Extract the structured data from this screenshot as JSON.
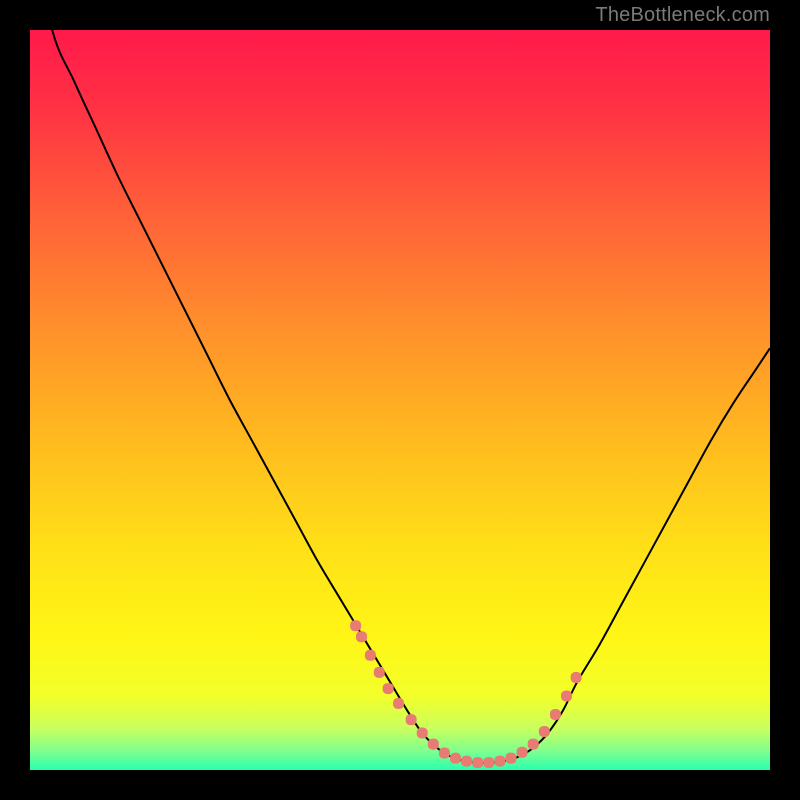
{
  "watermark": "TheBottleneck.com",
  "colors": {
    "background": "#000000",
    "curve": "#000000",
    "markers": "#e87c72",
    "gradient_stops": [
      {
        "offset": 0.0,
        "color": "#ff1a4b"
      },
      {
        "offset": 0.1,
        "color": "#ff3044"
      },
      {
        "offset": 0.25,
        "color": "#ff6138"
      },
      {
        "offset": 0.4,
        "color": "#ff8f2c"
      },
      {
        "offset": 0.55,
        "color": "#ffb91f"
      },
      {
        "offset": 0.7,
        "color": "#ffe018"
      },
      {
        "offset": 0.82,
        "color": "#fff615"
      },
      {
        "offset": 0.9,
        "color": "#f3ff2a"
      },
      {
        "offset": 0.945,
        "color": "#c8ff60"
      },
      {
        "offset": 0.975,
        "color": "#7dff8f"
      },
      {
        "offset": 1.0,
        "color": "#2bffb0"
      }
    ]
  },
  "chart_data": {
    "type": "line",
    "title": "",
    "xlabel": "",
    "ylabel": "",
    "xlim": [
      0,
      100
    ],
    "ylim": [
      0,
      100
    ],
    "grid": false,
    "legend": false,
    "series": [
      {
        "name": "bottleneck-curve",
        "x": [
          0,
          3,
          6,
          9,
          12,
          15,
          18,
          21,
          24,
          27,
          30,
          33,
          36,
          39,
          42,
          45,
          48,
          51,
          53,
          55,
          56.5,
          58,
          60,
          62,
          64,
          66,
          68,
          70,
          72,
          74,
          77,
          80,
          83,
          86,
          89,
          92,
          95,
          98,
          100
        ],
        "y": [
          115,
          100,
          93,
          86.5,
          80,
          74,
          68,
          62,
          56,
          50,
          44.5,
          39,
          33.5,
          28,
          23,
          18,
          13,
          8,
          5,
          3,
          2,
          1.4,
          1.0,
          1.0,
          1.2,
          1.8,
          3,
          5,
          8,
          12,
          17,
          22.5,
          28,
          33.5,
          39,
          44.5,
          49.5,
          54,
          57
        ]
      }
    ],
    "markers": {
      "name": "highlighted-points",
      "x": [
        44.0,
        44.8,
        46.0,
        47.2,
        48.4,
        49.8,
        51.5,
        53.0,
        54.5,
        56.0,
        57.5,
        59.0,
        60.5,
        62.0,
        63.5,
        65.0,
        66.5,
        68.0,
        69.5,
        71.0,
        72.5,
        73.8
      ],
      "y": [
        19.5,
        18.0,
        15.5,
        13.2,
        11.0,
        9.0,
        6.8,
        5.0,
        3.5,
        2.3,
        1.6,
        1.2,
        1.0,
        1.0,
        1.2,
        1.6,
        2.4,
        3.5,
        5.2,
        7.5,
        10.0,
        12.5
      ]
    }
  }
}
